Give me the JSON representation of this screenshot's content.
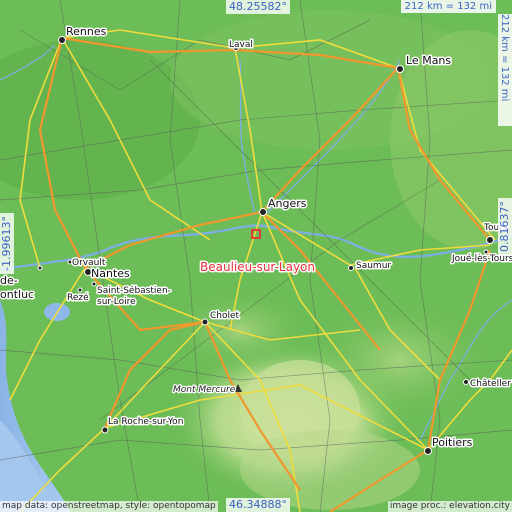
{
  "coordinates": {
    "top": "48.25582°",
    "bottom": "46.34888°",
    "left": "-1.99613°",
    "right": "0.81637°"
  },
  "scale": {
    "horizontal": "212 km = 132 mi",
    "vertical": "212 km = 132 mi"
  },
  "target": {
    "name": "Beaulieu-sur-Layon",
    "marker_color": "#e8303a"
  },
  "cities": {
    "rennes": "Rennes",
    "laval": "Laval",
    "le_mans": "Le Mans",
    "angers": "Angers",
    "saumur": "Saumur",
    "tours": "Tours",
    "joue": "Joué-lès-Tours",
    "nantes": "Nantes",
    "orvault": "Orvault",
    "reze": "Rezé",
    "saint_sebastien": "Saint-Sébastien-",
    "saint_sebastien_2": "sur-Loire",
    "cholet": "Cholet",
    "la_roche": "La Roche-sur-Yon",
    "poitiers": "Poitiers",
    "chatellerault": "Châteller",
    "saint_nazaire_fragment": "de-",
    "montluc_fragment": "ontluc"
  },
  "peak": {
    "name": "Mont Mercure"
  },
  "attribution": {
    "left": "map data: openstreetmap, style: opentopomap",
    "right": "image proc.: elevation.city"
  },
  "colors": {
    "lowland": "#6fbf5a",
    "highland": "#b9d98a",
    "water": "#8fb8e8",
    "motorway": "#f2a33a",
    "road": "#f4e04d",
    "label_blue": "#3b62c4"
  }
}
